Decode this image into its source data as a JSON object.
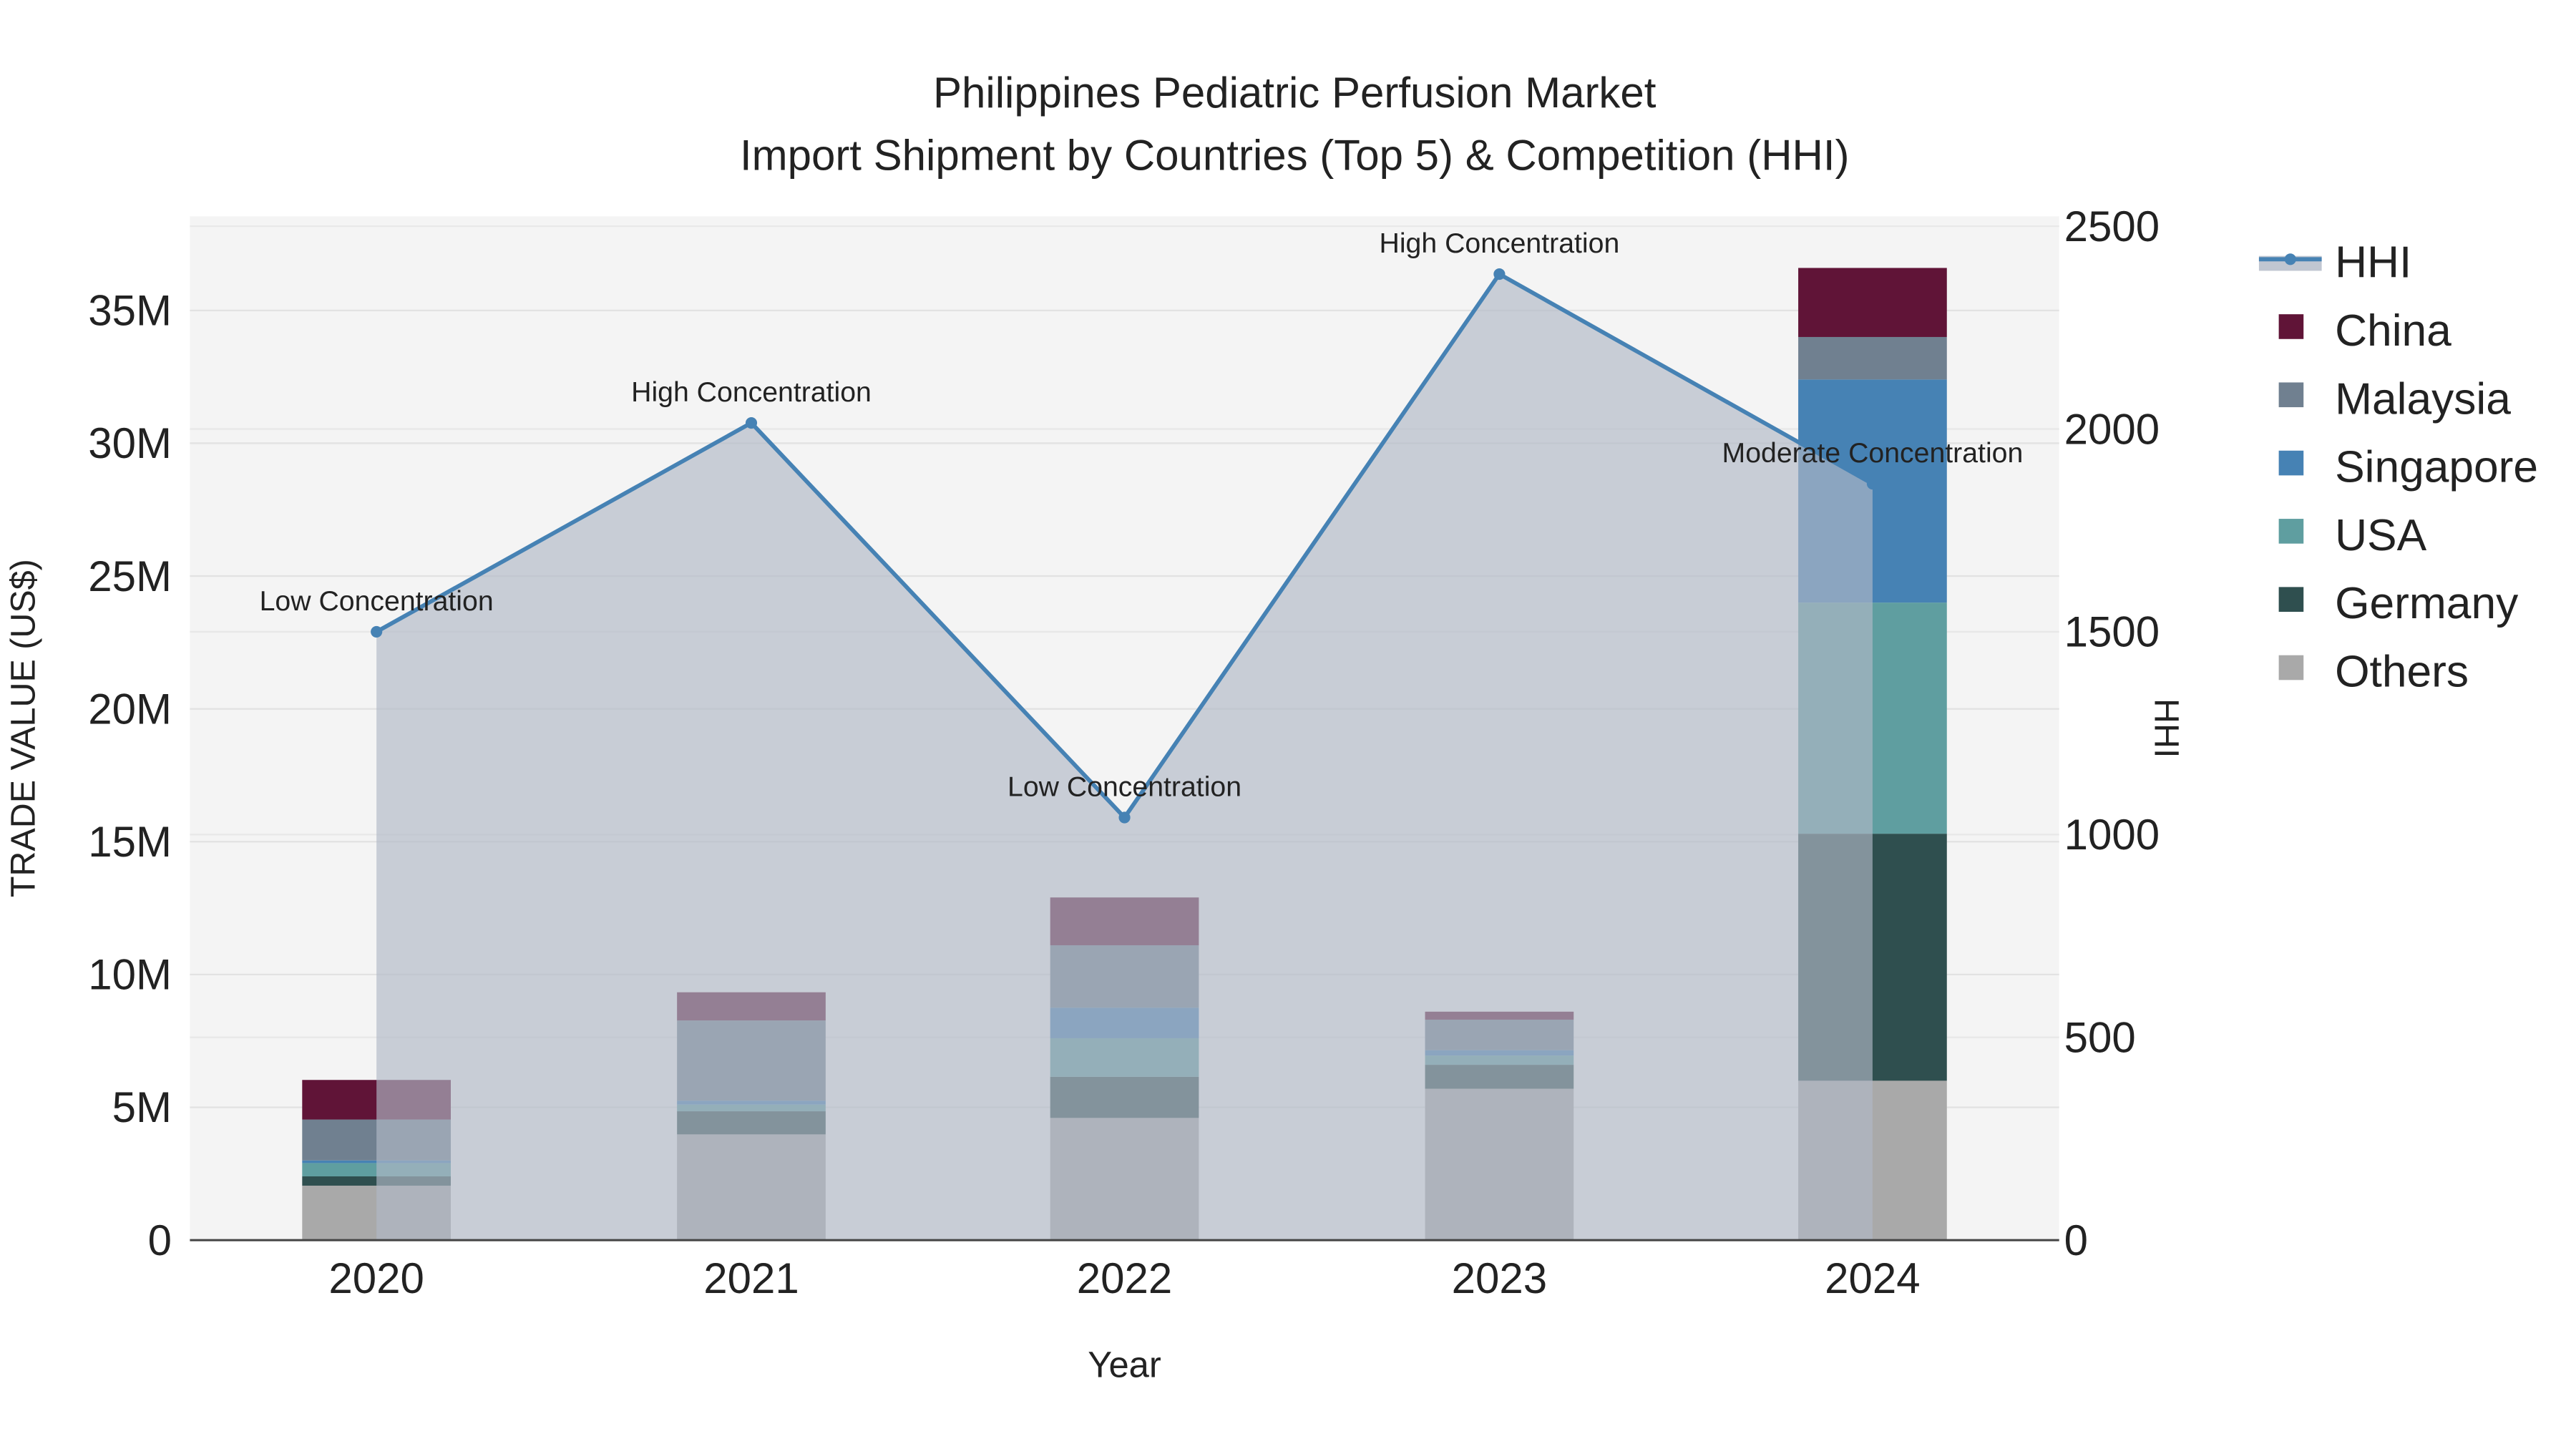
{
  "chart_data": {
    "type": "bar",
    "title_line1": "Philippines Pediatric Perfusion Market",
    "title_line2": "Import Shipment by Countries (Top 5) & Competition (HHI)",
    "xlabel": "Year",
    "ylabel": "TRADE VALUE (US$)",
    "y2label": "HHI",
    "categories": [
      "2020",
      "2021",
      "2022",
      "2023",
      "2024"
    ],
    "ylim": [
      0,
      38000000
    ],
    "y_ticks": [
      0,
      5000000,
      10000000,
      15000000,
      20000000,
      25000000,
      30000000,
      35000000
    ],
    "y_tick_labels": [
      "0",
      "5M",
      "10M",
      "15M",
      "20M",
      "25M",
      "30M",
      "35M"
    ],
    "y2lim": [
      0,
      2520
    ],
    "y2_ticks": [
      0,
      500,
      1000,
      1500,
      2000,
      2500
    ],
    "y2_tick_labels": [
      "0",
      "500",
      "1000",
      "1500",
      "2000",
      "2500"
    ],
    "grid": true,
    "legend_position": "right",
    "series": [
      {
        "name": "Others",
        "color": "#a9a9a9",
        "values": [
          2050000,
          3980000,
          4600000,
          5700000,
          6000000
        ]
      },
      {
        "name": "Germany",
        "color": "#2f4f4f",
        "values": [
          350000,
          870000,
          1550000,
          900000,
          9300000
        ]
      },
      {
        "name": "USA",
        "color": "#5f9ea0",
        "values": [
          500000,
          250000,
          1450000,
          350000,
          8700000
        ]
      },
      {
        "name": "Singapore",
        "color": "#4682b4",
        "values": [
          100000,
          150000,
          1150000,
          200000,
          8400000
        ]
      },
      {
        "name": "Malaysia",
        "color": "#708090",
        "values": [
          1540000,
          3020000,
          2350000,
          1150000,
          1600000
        ]
      },
      {
        "name": "China",
        "color": "#601437",
        "values": [
          1490000,
          1060000,
          1800000,
          300000,
          2600000
        ]
      }
    ],
    "legend_order": [
      "HHI",
      "China",
      "Malaysia",
      "Singapore",
      "USA",
      "Germany",
      "Others"
    ],
    "hhi": {
      "name": "HHI",
      "color": "#4682b4",
      "values": [
        1500,
        2015,
        1042,
        2382,
        1865
      ],
      "annotations": [
        "Low Concentration",
        "High Concentration",
        "Low Concentration",
        "High Concentration",
        "Moderate Concentration"
      ]
    }
  }
}
